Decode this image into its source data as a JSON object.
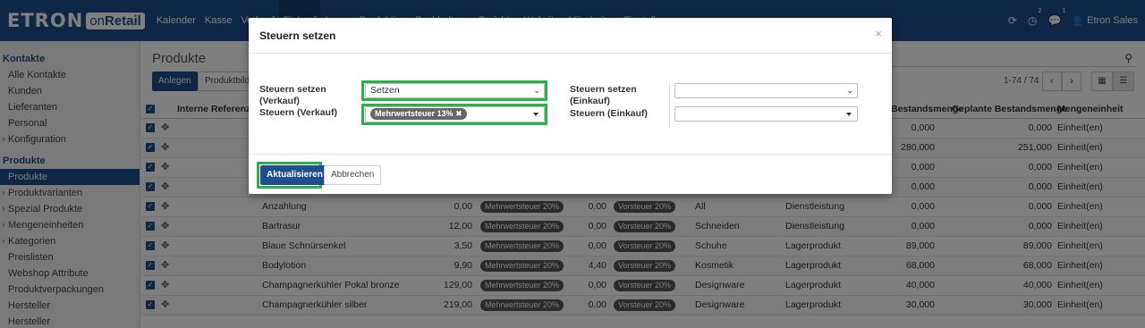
{
  "app": {
    "logo_main": "ETRON",
    "logo_on": "on",
    "logo_retail": "Retail"
  },
  "topnav": {
    "items": [
      "Kalender",
      "Kasse",
      "Verkauf",
      "Einkauf",
      "Lager",
      "Produktion",
      "Buchhaltung",
      "Berichte",
      "Website",
      "Mitarbeiter",
      "Einstellungen"
    ],
    "activities_badge": "2",
    "messages_badge": "1",
    "user": "Etron Sales"
  },
  "sidebar": {
    "section1": "Kontakte",
    "section1_items": [
      "Alle Kontakte",
      "Kunden",
      "Lieferanten",
      "Personal",
      "Konfiguration"
    ],
    "section2": "Produkte",
    "section2_items": [
      "Produkte",
      "Produktvarianten",
      "Spezial Produkte",
      "Mengeneinheiten",
      "Kategorien",
      "Preislisten",
      "Webshop Attribute",
      "Produktverpackungen",
      "Hersteller",
      "Hersteller"
    ]
  },
  "main": {
    "breadcrumb": "Produkte",
    "create_button": "Anlegen",
    "secondary_button": "Produktbilder",
    "pager": "1-74 / 74",
    "columns": {
      "ref": "Interne Referenz",
      "stock": "Bestandsmenge",
      "planned": "Geplante Bestandsmenge",
      "uom": "Mengeneinheit"
    },
    "rows": [
      {
        "name": "",
        "price": "",
        "tax_sale": "",
        "cost": "",
        "tax_buy": "",
        "category": "",
        "type": "",
        "stock": "0,000",
        "planned": "0,000",
        "uom": "Einheit(en)"
      },
      {
        "name": "",
        "price": "",
        "tax_sale": "",
        "cost": "",
        "tax_buy": "",
        "category": "",
        "type": "",
        "stock": "280,000",
        "planned": "251,000",
        "uom": "Einheit(en)"
      },
      {
        "name": "",
        "price": "",
        "tax_sale": "",
        "cost": "",
        "tax_buy": "",
        "category": "",
        "type": "",
        "stock": "0,000",
        "planned": "0,000",
        "uom": "Einheit(en)"
      },
      {
        "name": "",
        "price": "",
        "tax_sale": "",
        "cost": "",
        "tax_buy": "",
        "category": "",
        "type": "",
        "stock": "0,000",
        "planned": "0,000",
        "uom": "Einheit(en)"
      },
      {
        "name": "Anzahlung",
        "price": "0,00",
        "tax_sale": "Mehrwertsteuer 20%",
        "cost": "0,00",
        "tax_buy": "Vorsteuer 20%",
        "category": "All",
        "type": "Dienstleistung",
        "stock": "0,000",
        "planned": "0,000",
        "uom": "Einheit(en)"
      },
      {
        "name": "Bartrasur",
        "price": "12,00",
        "tax_sale": "Mehrwertsteuer 20%",
        "cost": "0,00",
        "tax_buy": "Vorsteuer 20%",
        "category": "Schneiden",
        "type": "Dienstleistung",
        "stock": "0,000",
        "planned": "0,000",
        "uom": "Einheit(en)"
      },
      {
        "name": "Blaue Schnürsenkel",
        "price": "3,50",
        "tax_sale": "Mehrwertsteuer 20%",
        "cost": "0,00",
        "tax_buy": "Vorsteuer 20%",
        "category": "Schuhe",
        "type": "Lagerprodukt",
        "stock": "89,000",
        "planned": "89,000",
        "uom": "Einheit(en)"
      },
      {
        "name": "Bodylotion",
        "price": "9,90",
        "tax_sale": "Mehrwertsteuer 20%",
        "cost": "4,40",
        "tax_buy": "Vorsteuer 20%",
        "category": "Kosmetik",
        "type": "Lagerprodukt",
        "stock": "68,000",
        "planned": "68,000",
        "uom": "Einheit(en)"
      },
      {
        "name": "Champagnerkühler Pokal bronze",
        "price": "129,00",
        "tax_sale": "Mehrwertsteuer 20%",
        "cost": "0,00",
        "tax_buy": "Vorsteuer 20%",
        "category": "Designware",
        "type": "Lagerprodukt",
        "stock": "40,000",
        "planned": "40,000",
        "uom": "Einheit(en)"
      },
      {
        "name": "Champagnerkühler silber",
        "price": "219,00",
        "tax_sale": "Mehrwertsteuer 20%",
        "cost": "0,00",
        "tax_buy": "Vorsteuer 20%",
        "category": "Designware",
        "type": "Lagerprodukt",
        "stock": "30,000",
        "planned": "30,000",
        "uom": "Einheit(en)"
      }
    ]
  },
  "modal": {
    "title": "Steuern setzen",
    "label_set_sale": "Steuern setzen (Verkauf)",
    "label_tax_sale": "Steuern (Verkauf)",
    "label_set_buy": "Steuern setzen (Einkauf)",
    "label_tax_buy": "Steuern (Einkauf)",
    "set_sale_value": "Setzen",
    "tax_sale_tag": "Mehrwertsteuer 13%",
    "set_buy_value": "",
    "tax_buy_value": "",
    "update_button": "Aktualisieren",
    "cancel_button": "Abbrechen"
  },
  "colors": {
    "brand": "#1f4e8c",
    "highlight": "#2bb04c"
  }
}
